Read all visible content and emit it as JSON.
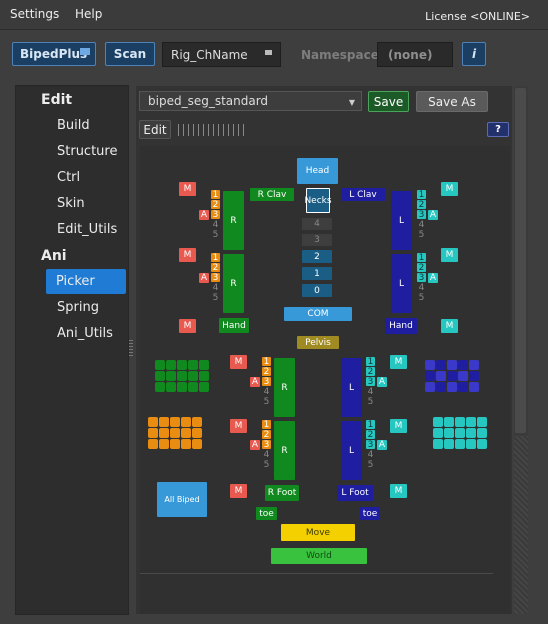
{
  "menu": {
    "settings": "Settings",
    "help": "Help",
    "license": "License <ONLINE>"
  },
  "toolbar": {
    "product": "BipedPlus",
    "scan": "Scan",
    "rig_name": "Rig_ChName",
    "namespace_label": "Namespace:",
    "namespace_value": "(none)",
    "info": "i"
  },
  "sidebar": {
    "edit_header": "Edit",
    "ani_header": "Ani",
    "edit_items": [
      "Build",
      "Structure",
      "Ctrl",
      "Skin",
      "Edit_Utils"
    ],
    "ani_items": [
      "Picker",
      "Spring",
      "Ani_Utils"
    ],
    "active": "Picker"
  },
  "picker_bar": {
    "preset": "biped_seg_standard",
    "save": "Save",
    "save_as": "Save As",
    "edit": "Edit",
    "help": "?"
  },
  "buttons": {
    "head": "Head",
    "necks": "Necks",
    "r_clav": "R Clav",
    "l_clav": "L Clav",
    "r_arm": "R",
    "l_arm": "L",
    "r_leg": "R",
    "l_leg": "L",
    "r_hand": "Hand",
    "l_hand": "Hand",
    "com": "COM",
    "pelvis": "Pelvis",
    "r_foot": "R Foot",
    "l_foot": "L Foot",
    "toe": "toe",
    "move": "Move",
    "world": "World",
    "all_biped": "All Biped",
    "m": "M",
    "a": "A"
  },
  "finger_digits": [
    "1",
    "2",
    "3",
    "4",
    "5"
  ],
  "neck_digits": [
    "4",
    "3",
    "2",
    "1",
    "0"
  ],
  "colors": {
    "red_side": "#e85a4f",
    "green": "#108a1e",
    "blue": "#1f1ea0",
    "teal": "#27c7c1",
    "orange": "#e88d12",
    "sky": "#3799d8",
    "move": "#f5d000",
    "world": "#38c23d",
    "pelvis": "#a08a22"
  }
}
